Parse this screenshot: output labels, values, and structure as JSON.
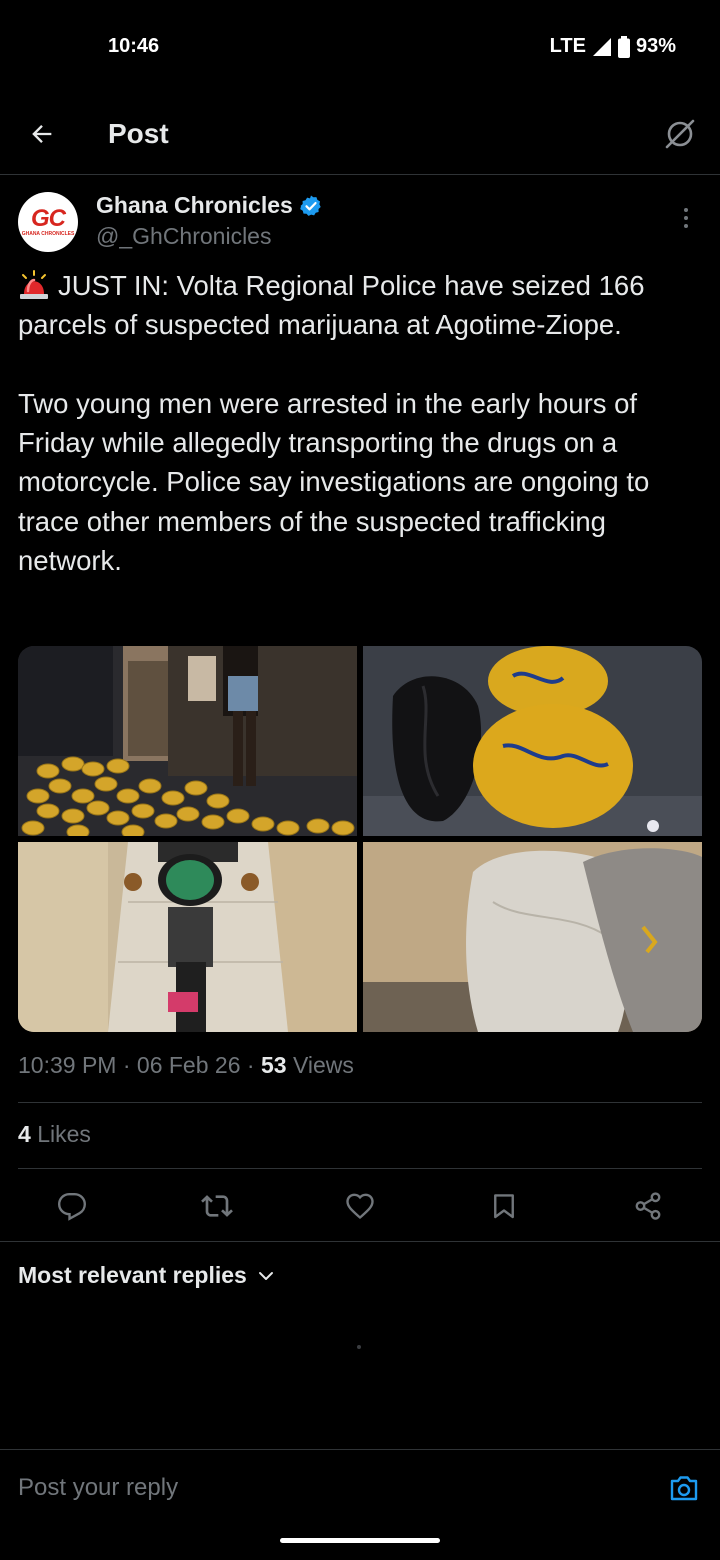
{
  "status_bar": {
    "time": "10:46",
    "network": "LTE",
    "battery": "93%"
  },
  "header": {
    "title": "Post"
  },
  "author": {
    "name": "Ghana Chronicles",
    "handle": "@_GhChronicles",
    "verified": true,
    "avatar_text": "GC",
    "avatar_subtext": "GHANA CHRONICLES",
    "brand_color": "#d7261f"
  },
  "tweet": {
    "emoji": "siren-icon",
    "paragraph1": "JUST IN: Volta Regional Police have seized 166 parcels of suspected marijuana at Agotime-Ziope.",
    "paragraph2": "Two young men were arrested in the early hours of Friday while allegedly transporting the drugs on a motorcycle. Police say investigations are ongoing to trace other members of the suspected trafficking network."
  },
  "meta": {
    "time": "10:39 PM",
    "sep1": "·",
    "date": "06 Feb 26",
    "sep2": "·",
    "views_count": "53",
    "views_label": "Views"
  },
  "likes": {
    "count": "4",
    "label": "Likes"
  },
  "replies": {
    "sort_label": "Most relevant replies"
  },
  "reply_bar": {
    "placeholder": "Post your reply"
  },
  "colors": {
    "accent": "#1d9bf0",
    "background": "#000000",
    "muted": "#71767b",
    "divider": "#2f3336"
  }
}
